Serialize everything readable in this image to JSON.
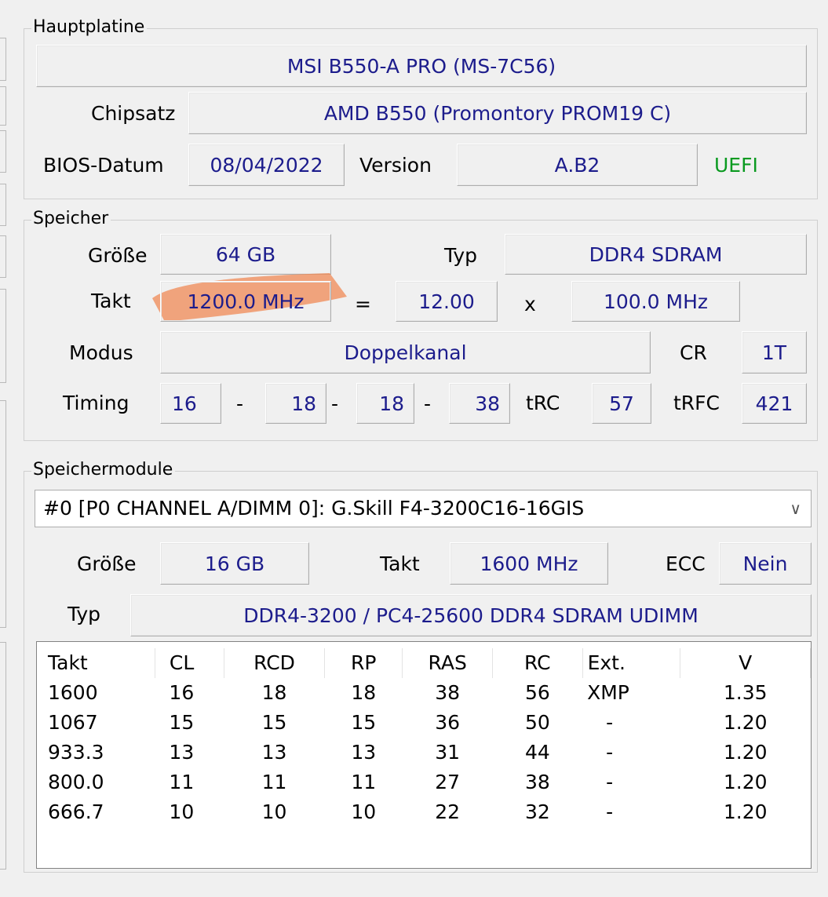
{
  "mainboard": {
    "legend": "Hauptplatine",
    "model": "MSI B550-A PRO (MS-7C56)",
    "chipset_label": "Chipsatz",
    "chipset": "AMD B550 (Promontory PROM19 C)",
    "bios_date_label": "BIOS-Datum",
    "bios_date": "08/04/2022",
    "version_label": "Version",
    "version": "A.B2",
    "uefi": "UEFI"
  },
  "memory": {
    "legend": "Speicher",
    "size_label": "Größe",
    "size": "64 GB",
    "type_label": "Typ",
    "type": "DDR4 SDRAM",
    "clock_label": "Takt",
    "clock": "1200.0 MHz",
    "equals": "=",
    "multiplier": "12.00",
    "times": "x",
    "base_clock": "100.0 MHz",
    "mode_label": "Modus",
    "mode": "Doppelkanal",
    "cr_label": "CR",
    "cr": "1T",
    "timing_label": "Timing",
    "timings": [
      "16",
      "18",
      "18",
      "38"
    ],
    "dash": "-",
    "trc_label": "tRC",
    "trc": "57",
    "trfc_label": "tRFC",
    "trfc": "421"
  },
  "modules": {
    "legend": "Speichermodule",
    "selected": "#0 [P0 CHANNEL A/DIMM 0]: G.Skill F4-3200C16-16GIS",
    "size_label": "Größe",
    "size": "16 GB",
    "clock_label": "Takt",
    "clock": "1600 MHz",
    "ecc_label": "ECC",
    "ecc": "Nein",
    "type_label": "Typ",
    "type": "DDR4-3200 / PC4-25600 DDR4 SDRAM UDIMM",
    "table": {
      "headers": [
        "Takt",
        "CL",
        "RCD",
        "RP",
        "RAS",
        "RC",
        "Ext.",
        "V"
      ],
      "rows": [
        [
          "1600",
          "16",
          "18",
          "18",
          "38",
          "56",
          "XMP",
          "1.35"
        ],
        [
          "1067",
          "15",
          "15",
          "15",
          "36",
          "50",
          "-",
          "1.20"
        ],
        [
          "933.3",
          "13",
          "13",
          "13",
          "31",
          "44",
          "-",
          "1.20"
        ],
        [
          "800.0",
          "11",
          "11",
          "11",
          "27",
          "38",
          "-",
          "1.20"
        ],
        [
          "666.7",
          "10",
          "10",
          "10",
          "22",
          "32",
          "-",
          "1.20"
        ]
      ]
    }
  },
  "colors": {
    "value_text": "#1c1c8c",
    "uefi_green": "#0a9a20",
    "highlight_stroke": "#f08a55"
  }
}
